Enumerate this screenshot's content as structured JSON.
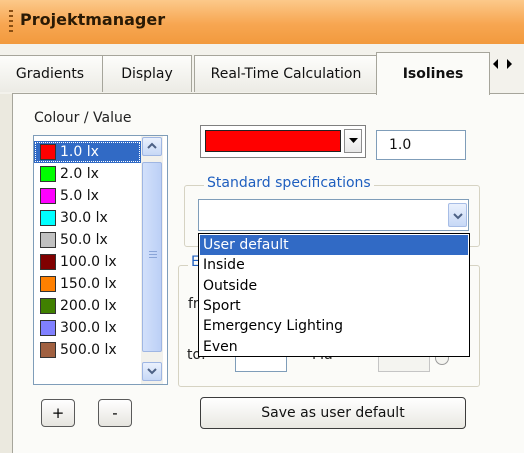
{
  "window": {
    "title": "Projektmanager"
  },
  "tabs": [
    {
      "label": "Gradients",
      "active": false
    },
    {
      "label": "Display",
      "active": false
    },
    {
      "label": "Real-Time Calculation",
      "active": false
    },
    {
      "label": "Isolines",
      "active": true
    }
  ],
  "isolines": {
    "list_label": "Colour / Value",
    "items": [
      {
        "label": "1.0 lx",
        "color": "#ff0000",
        "selected": true
      },
      {
        "label": "2.0 lx",
        "color": "#00ff00",
        "selected": false
      },
      {
        "label": "5.0 lx",
        "color": "#ff00ff",
        "selected": false
      },
      {
        "label": "30.0 lx",
        "color": "#00ffff",
        "selected": false
      },
      {
        "label": "50.0 lx",
        "color": "#c0c0c0",
        "selected": false
      },
      {
        "label": "100.0 lx",
        "color": "#800000",
        "selected": false
      },
      {
        "label": "150.0 lx",
        "color": "#ff8000",
        "selected": false
      },
      {
        "label": "200.0 lx",
        "color": "#408000",
        "selected": false
      },
      {
        "label": "300.0 lx",
        "color": "#8080ff",
        "selected": false
      },
      {
        "label": "500.0 lx",
        "color": "#a06040",
        "selected": false
      }
    ],
    "add_label": "+",
    "remove_label": "-",
    "selected_color": "#ff0000",
    "value": "1.0",
    "standard_specs": {
      "legend": "Standard specifications",
      "current": "",
      "options": [
        {
          "label": "User default",
          "selected": true
        },
        {
          "label": "Inside",
          "selected": false
        },
        {
          "label": "Outside",
          "selected": false
        },
        {
          "label": "Sport",
          "selected": false
        },
        {
          "label": "Emergency Lighting",
          "selected": false
        },
        {
          "label": "Even",
          "selected": false
        }
      ]
    },
    "partially_hidden": {
      "legend": "E",
      "from_label": "fr",
      "to_label": "to:",
      "to_value": "",
      "mmd_label": "Ma",
      "mmd_value": ""
    },
    "save_label": "Save as user default"
  },
  "colors": {
    "titlebar": "#f7a651",
    "selection": "#316ac5",
    "group_legend": "#1f5fbf"
  }
}
